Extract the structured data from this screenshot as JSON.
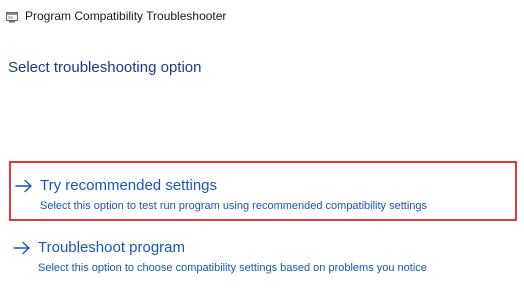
{
  "window": {
    "title": "Program Compatibility Troubleshooter",
    "icon": "troubleshooter-app-icon"
  },
  "main": {
    "heading": "Select troubleshooting option",
    "options": [
      {
        "title": "Try recommended settings",
        "description": "Select this option to test run program using recommended compatibility settings",
        "icon": "arrow-right-icon",
        "highlighted": true
      },
      {
        "title": "Troubleshoot program",
        "description": "Select this option to choose compatibility settings based on problems you notice",
        "icon": "arrow-right-icon",
        "highlighted": false
      }
    ]
  },
  "colors": {
    "heading": "#1c3a88",
    "link": "#1757b8",
    "highlight_border": "#e3373f"
  }
}
